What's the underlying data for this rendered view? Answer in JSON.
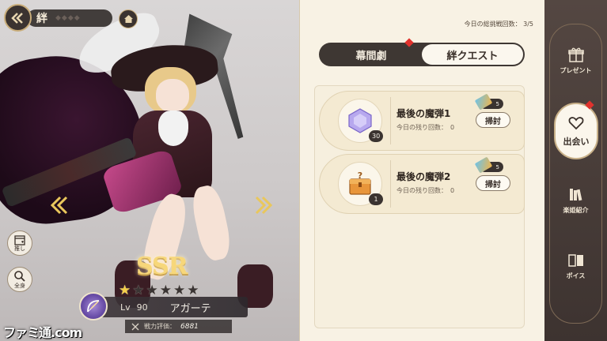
{
  "header": {
    "title": "絆"
  },
  "side_buttons": {
    "oshi_label": "推し",
    "fullbody_label": "全身"
  },
  "character": {
    "rarity": "SSR",
    "stars_total": 6,
    "stars_filled": 1,
    "lv_label": "Lv",
    "level": "90",
    "name": "アガーテ",
    "power_label": "戦力評価：",
    "power_value": "6881"
  },
  "watermark": "ファミ通.com",
  "panel": {
    "counter": "今日の総挑戦回数： 3/5",
    "tabs": [
      {
        "label": "幕間劇",
        "active": false
      },
      {
        "label": "絆クエスト",
        "active": true
      }
    ],
    "quests": [
      {
        "title": "最後の魔弾1",
        "remaining_label": "今日の残り回数：",
        "remaining": "0",
        "item_qty": "30",
        "ticket_count": "5",
        "sweep_label": "掃討",
        "icon": "crystal-icon"
      },
      {
        "title": "最後の魔弾2",
        "remaining_label": "今日の残り回数：",
        "remaining": "0",
        "item_qty": "1",
        "ticket_count": "5",
        "sweep_label": "掃討",
        "icon": "treasure-box-icon"
      }
    ]
  },
  "right_menu": [
    {
      "label": "プレゼント",
      "icon": "gift-icon",
      "active": false
    },
    {
      "label": "出会い",
      "icon": "heart-speech-icon",
      "active": true
    },
    {
      "label": "楽姫紹介",
      "icon": "books-icon",
      "active": false
    },
    {
      "label": "ボイス",
      "icon": "book-open-icon",
      "active": false
    }
  ],
  "colors": {
    "accent_gold": "#c9ad7a",
    "notify_red": "#e0322d",
    "dark_panel": "#3e3733",
    "parchment": "#f8f2e4"
  }
}
